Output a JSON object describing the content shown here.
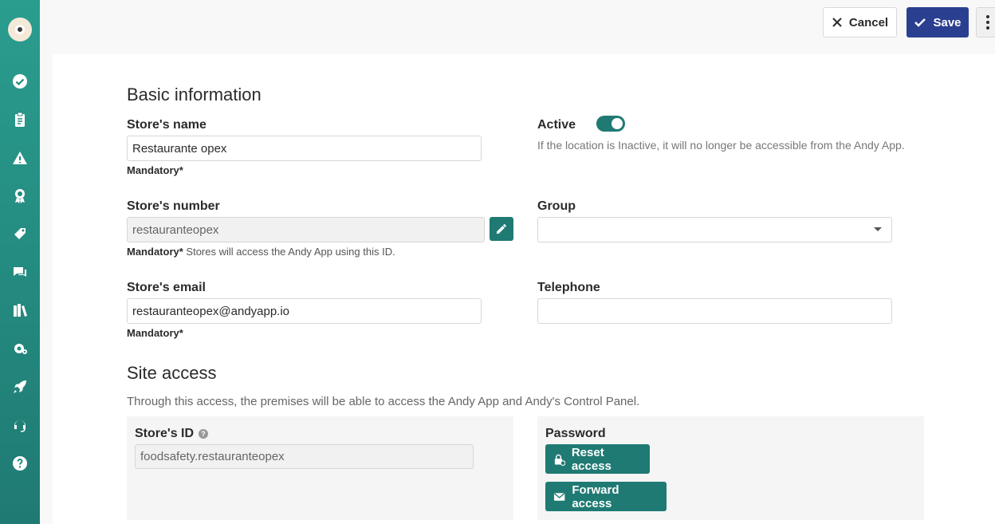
{
  "toolbar": {
    "cancel_label": "Cancel",
    "save_label": "Save"
  },
  "basic": {
    "title": "Basic information",
    "store_name": {
      "label": "Store's name",
      "value": "Restaurante opex",
      "hint": "Mandatory*"
    },
    "active": {
      "label": "Active",
      "enabled": true,
      "description": "If the location is Inactive, it will no longer be accessible from the Andy App."
    },
    "store_number": {
      "label": "Store's number",
      "value": "restauranteopex",
      "hint_strong": "Mandatory*",
      "hint": " Stores will access the Andy App using this ID."
    },
    "group": {
      "label": "Group",
      "value": ""
    },
    "store_email": {
      "label": "Store's email",
      "value": "restauranteopex@andyapp.io",
      "hint": "Mandatory*"
    },
    "telephone": {
      "label": "Telephone",
      "value": ""
    }
  },
  "site_access": {
    "title": "Site access",
    "description": "Through this access, the premises will be able to access the Andy App and Andy's Control Panel.",
    "store_id": {
      "label": "Store's ID",
      "value": "foodsafety.restauranteopex"
    },
    "password": {
      "label": "Password"
    },
    "reset_label": "Reset access",
    "forward_label": "Forward access"
  },
  "sidebar_icons": [
    "logo-icon",
    "check-icon",
    "clipboard-icon",
    "warning-icon",
    "award-icon",
    "tag-icon",
    "chat-icon",
    "library-icon",
    "settings-icon",
    "rocket-icon",
    "headset-icon",
    "help-icon"
  ],
  "colors": {
    "sidebar": "#2a9d8f",
    "accent": "#1f7a73",
    "save": "#2a3f8f"
  }
}
